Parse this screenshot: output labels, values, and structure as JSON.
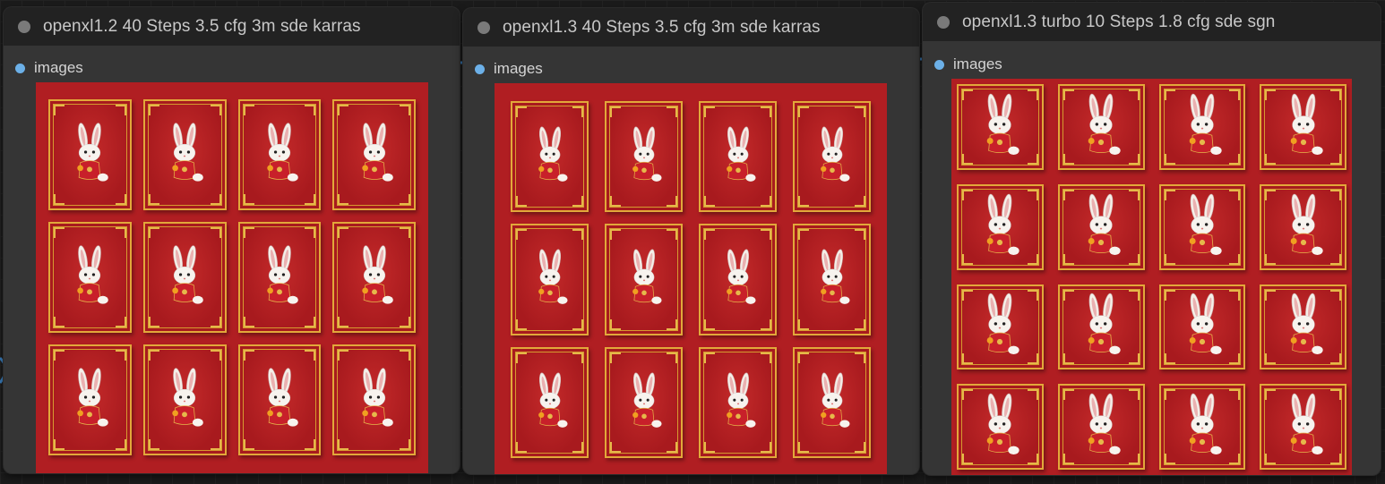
{
  "colors": {
    "canvas": "#1b1b1b",
    "node_body": "#353535",
    "node_header": "#222222",
    "port": "#6cb0e8",
    "card_red": "#b01e22",
    "gold": "#e2a83a"
  },
  "nodes": [
    {
      "title": "openxl1.2 40 Steps 3.5 cfg 3m sde karras",
      "output_label": "images",
      "grid": {
        "cols": 4,
        "rows": 3
      },
      "variant": "portrait",
      "icons": [
        "rabbit-card-icon"
      ]
    },
    {
      "title": "openxl1.3 40 Steps 3.5 cfg 3m sde karras",
      "output_label": "images",
      "grid": {
        "cols": 4,
        "rows": 3
      },
      "variant": "portrait",
      "icons": [
        "rabbit-card-icon"
      ]
    },
    {
      "title": "openxl1.3 turbo 10 Steps 1.8 cfg sde sgn",
      "output_label": "images",
      "grid": {
        "cols": 4,
        "rows": 4
      },
      "variant": "square",
      "icons": [
        "rabbit-card-icon"
      ]
    }
  ]
}
